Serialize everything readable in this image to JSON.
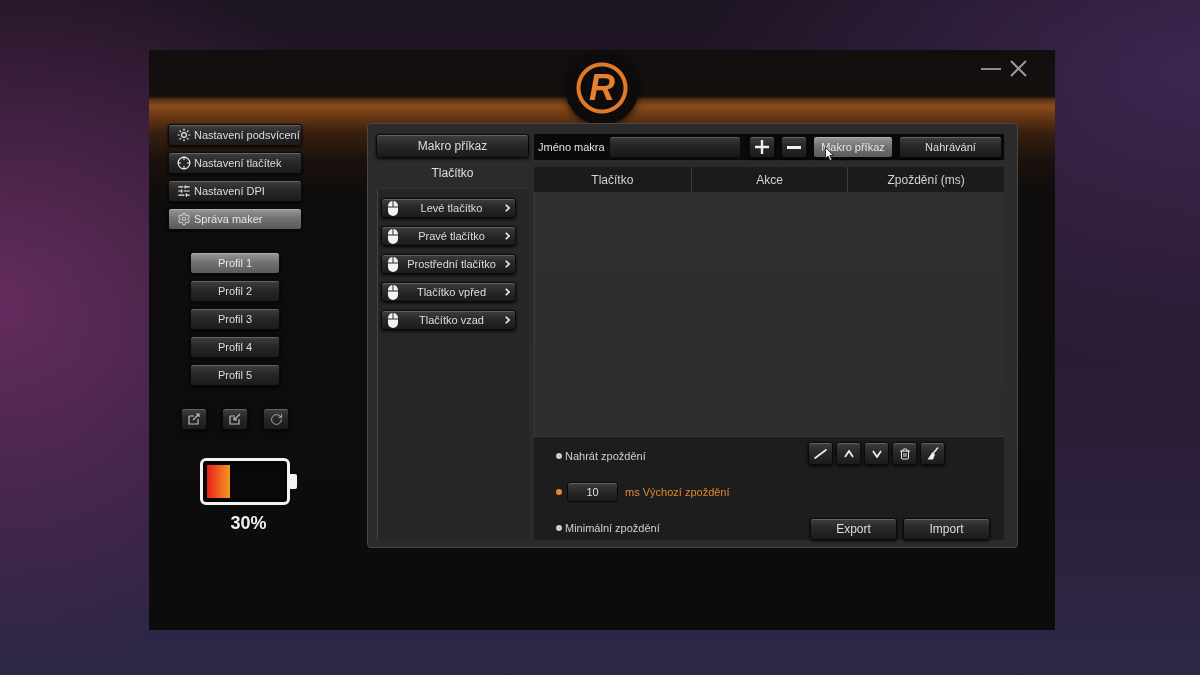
{
  "window": {
    "logo": "R"
  },
  "sidebar": {
    "menu": [
      {
        "label": "Nastavení podsvícení",
        "selected": false
      },
      {
        "label": "Nastavení tlačítek",
        "selected": false
      },
      {
        "label": "Nastavení DPI",
        "selected": false
      },
      {
        "label": "Správa maker",
        "selected": true
      }
    ],
    "profiles": [
      {
        "label": "Profil 1",
        "selected": true
      },
      {
        "label": "Profil 2",
        "selected": false
      },
      {
        "label": "Profil 3",
        "selected": false
      },
      {
        "label": "Profil 4",
        "selected": false
      },
      {
        "label": "Profil 5",
        "selected": false
      }
    ],
    "battery": {
      "level": 0.3,
      "reading": "30%"
    }
  },
  "macro_list": {
    "header_button": "Makro příkaz",
    "heading": "Tlačítko",
    "items": [
      "Levé tlačítko",
      "Pravé tlačítko",
      "Prostřední tlačítko",
      "Tlačítko vpřed",
      "Tlačítko vzad"
    ]
  },
  "editor": {
    "name_label": "Jméno makra",
    "modes": [
      {
        "label": "Makro příkaz",
        "selected": true
      },
      {
        "label": "Nahrávání",
        "selected": false
      }
    ],
    "table": {
      "columns": [
        "Tlačítko",
        "Akce",
        "Zpoždění (ms)"
      ]
    },
    "delay_options": [
      {
        "kind": "plain",
        "label": "Nahrát zpoždění",
        "selected": false
      },
      {
        "kind": "input",
        "value": "10",
        "label": "ms Výchozí zpoždění",
        "selected": true
      },
      {
        "kind": "plain",
        "label": "Minimální zpoždění",
        "selected": false
      }
    ],
    "actions": [
      "Export",
      "Import"
    ]
  }
}
